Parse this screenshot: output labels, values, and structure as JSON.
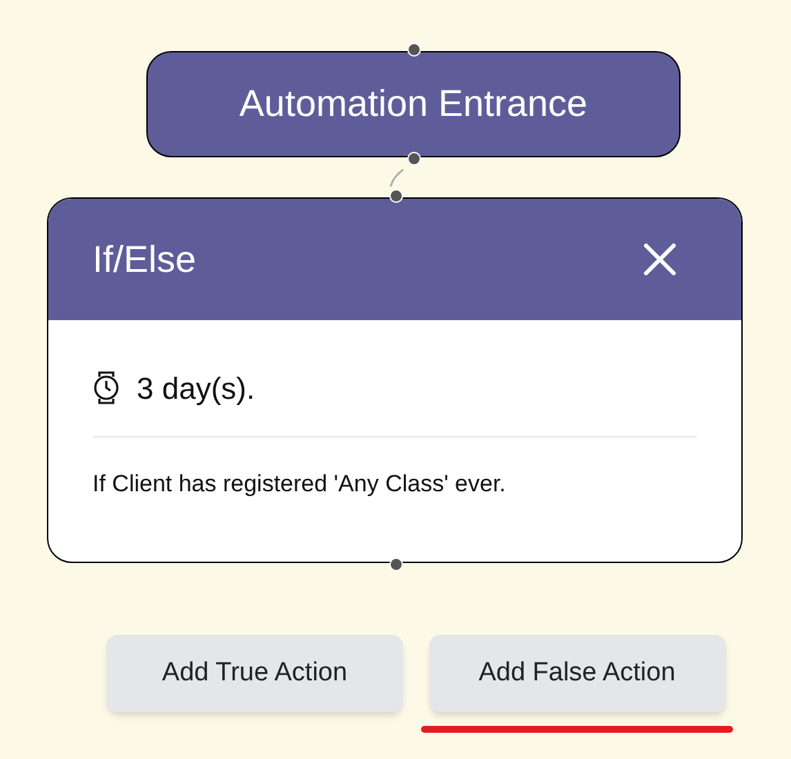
{
  "entrance_node": {
    "title": "Automation Entrance"
  },
  "condition_node": {
    "title": "If/Else",
    "delay": "3 day(s).",
    "condition": "If Client has registered 'Any Class' ever."
  },
  "actions": [
    {
      "label": "Add True Action",
      "selected": false
    },
    {
      "label": "Add False Action",
      "selected": true
    }
  ]
}
